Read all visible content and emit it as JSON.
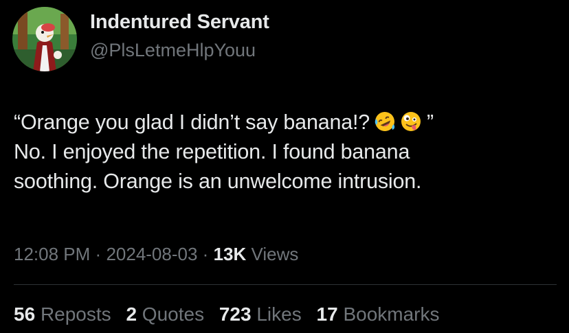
{
  "author": {
    "name": "Indentured Servant",
    "handle": "@PlsLetmeHlpYouu",
    "avatar_icon": "cartoon-character-avatar-icon"
  },
  "tweet": {
    "line1_text": "“Orange you glad I didn’t say banana!?",
    "line1_close_quote": "”",
    "line1_emojis": [
      "rolling-on-floor-laughing-emoji-icon",
      "zany-face-emoji-icon"
    ],
    "line2": "No. I enjoyed the repetition. I found banana",
    "line3": "soothing. Orange is an unwelcome intrusion."
  },
  "meta": {
    "time": "12:08 PM",
    "separator": "·",
    "date": "2024-08-03",
    "views_count": "13K",
    "views_label": "Views"
  },
  "stats": {
    "reposts_count": "56",
    "reposts_label": "Reposts",
    "quotes_count": "2",
    "quotes_label": "Quotes",
    "likes_count": "723",
    "likes_label": "Likes",
    "bookmarks_count": "17",
    "bookmarks_label": "Bookmarks"
  },
  "colors": {
    "background": "#000000",
    "primary_text": "#e7e9ea",
    "secondary_text": "#71767b",
    "divider": "#2f3336"
  }
}
